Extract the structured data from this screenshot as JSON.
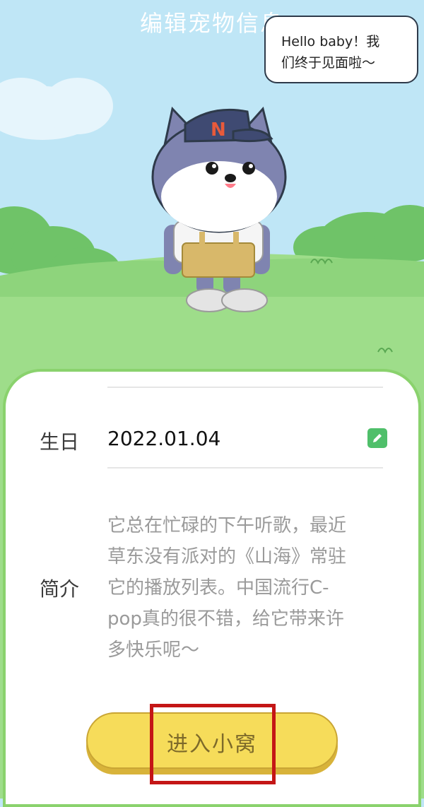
{
  "header": {
    "title": "编辑宠物信息"
  },
  "bubble": {
    "line1": "Hello baby！我",
    "line2": "们终于见面啦～"
  },
  "pet": {
    "cap_letter": "N"
  },
  "form": {
    "birthday": {
      "label": "生日",
      "value": "2022.01.04"
    },
    "intro": {
      "label": "简介",
      "lines": [
        "它总在忙碌的下午听歌，最近",
        "草东没有派对的《山海》常驻",
        "它的播放列表。中国流行C-",
        "pop真的很不错，给它带来许",
        "多快乐呢～"
      ]
    }
  },
  "actions": {
    "enter_label": "进入小窝"
  },
  "colors": {
    "sky": "#bfe6f6",
    "grass": "#9edd8a",
    "card_border": "#8ad26d",
    "button": "#f6dc5a",
    "highlight": "#c41616"
  },
  "icons": {
    "edit": "pencil-edit-icon"
  }
}
